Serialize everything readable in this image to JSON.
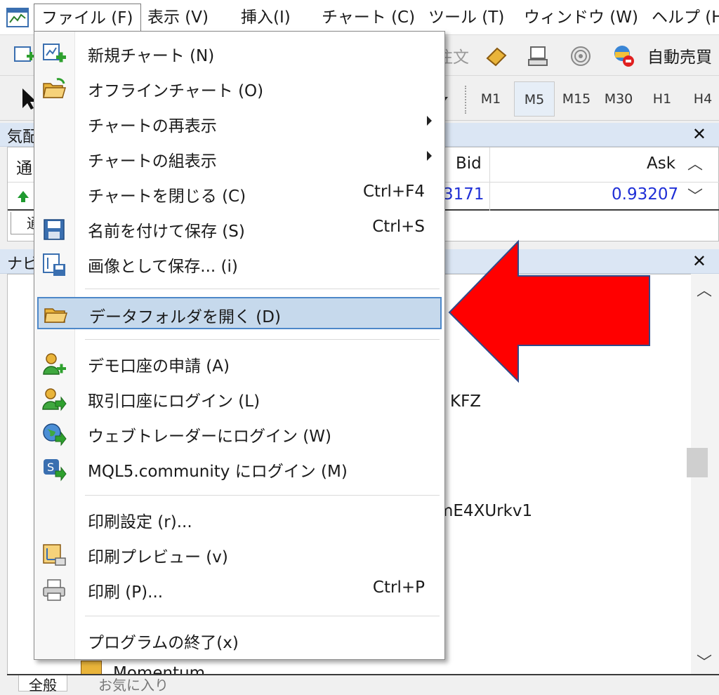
{
  "menubar": {
    "items": [
      {
        "label": "ファイル (F)"
      },
      {
        "label": "表示 (V)"
      },
      {
        "label": "挿入(I)"
      },
      {
        "label": "チャート (C)"
      },
      {
        "label": "ツール (T)"
      },
      {
        "label": "ウィンドウ (W)"
      },
      {
        "label": "ヘルプ (H"
      }
    ]
  },
  "toolbar1": {
    "order_fragment": "注文",
    "auto_trade_label": "自動売買"
  },
  "toolbar2": {
    "timeframes": [
      "M1",
      "M5",
      "M15",
      "M30",
      "H1",
      "H4"
    ],
    "active_timeframe": "M5"
  },
  "market_watch": {
    "title_fragment": "気配",
    "header_symbol_fragment": "通",
    "header_bid": "Bid",
    "header_ask": "Ask",
    "row_bid_fragment": "3171",
    "row_ask": "0.93207",
    "tab_fragment": "通"
  },
  "navigator": {
    "title_fragment": "ナビ",
    "text_fragment_1": "KFZ",
    "text_fragment_2": "mE4XUrkv1",
    "partial_item": "Momentum",
    "tabs": [
      "全般",
      "お気に入り"
    ]
  },
  "file_menu": {
    "items": [
      {
        "label": "新規チャート (N)",
        "shortcut": "",
        "icon": "new-chart-icon"
      },
      {
        "label": "オフラインチャート (O)",
        "shortcut": "",
        "icon": "folder-open-icon"
      },
      {
        "label": "チャートの再表示",
        "shortcut": "",
        "icon": ""
      },
      {
        "label": "チャートの組表示",
        "shortcut": "",
        "icon": ""
      },
      {
        "label": "チャートを閉じる (C)",
        "shortcut": "Ctrl+F4",
        "icon": ""
      },
      {
        "label": "名前を付けて保存 (S)",
        "shortcut": "Ctrl+S",
        "icon": "save-icon"
      },
      {
        "label": "画像として保存... (i)",
        "shortcut": "",
        "icon": "save-picture-icon"
      },
      {
        "label": "データフォルダを開く (D)",
        "shortcut": "",
        "icon": "folder-icon"
      },
      {
        "label": "デモ口座の申請 (A)",
        "shortcut": "",
        "icon": "user-add-icon"
      },
      {
        "label": "取引口座にログイン (L)",
        "shortcut": "",
        "icon": "user-login-icon"
      },
      {
        "label": "ウェブトレーダーにログイン (W)",
        "shortcut": "",
        "icon": "globe-login-icon"
      },
      {
        "label": "MQL5.community にログイン (M)",
        "shortcut": "",
        "icon": "mql5-login-icon"
      },
      {
        "label": "印刷設定 (r)...",
        "shortcut": "",
        "icon": ""
      },
      {
        "label": "印刷プレビュー (v)",
        "shortcut": "",
        "icon": "print-preview-icon"
      },
      {
        "label": "印刷 (P)...",
        "shortcut": "Ctrl+P",
        "icon": "printer-icon"
      },
      {
        "label": "プログラムの終了(x)",
        "shortcut": "",
        "icon": ""
      }
    ],
    "highlighted_item": "データフォルダを開く (D)"
  },
  "colors": {
    "highlight_bg": "#c6d9ec",
    "highlight_border": "#4d88c9",
    "panel_title_bg": "#dbe6f4",
    "price_blue": "#1f2fd6",
    "annotation_red": "#ff0000"
  }
}
